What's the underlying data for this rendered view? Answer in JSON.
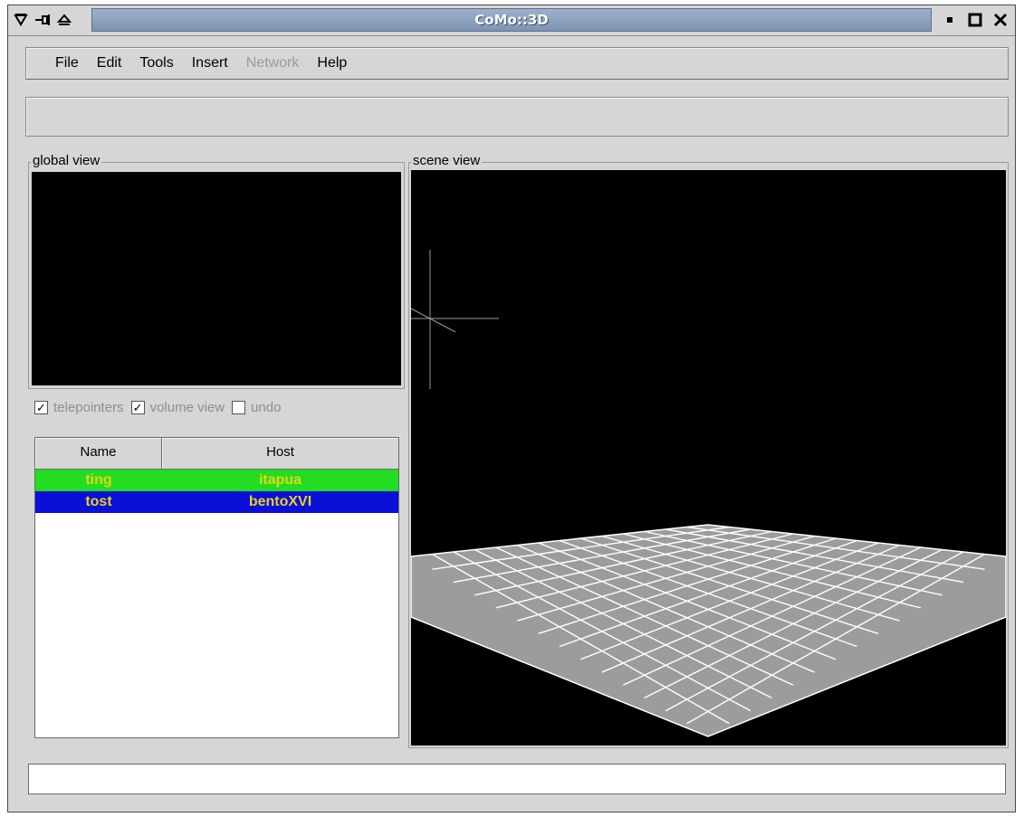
{
  "window": {
    "title": "CoMo::3D",
    "controls_left": [
      "window-menu-icon",
      "pin-icon",
      "shade-icon"
    ],
    "controls_right": [
      "minimize-icon",
      "maximize-icon",
      "close-icon"
    ]
  },
  "menu": {
    "file": "File",
    "edit": "Edit",
    "tools": "Tools",
    "insert": "Insert",
    "network": "Network",
    "help": "Help"
  },
  "panels": {
    "global_view": "global view",
    "scene_view": "scene view"
  },
  "options": {
    "telepointers": {
      "label": "telepointers",
      "checked": true
    },
    "volume_view": {
      "label": "volume view",
      "checked": true
    },
    "undo": {
      "label": "undo",
      "checked": false
    }
  },
  "users_table": {
    "columns": [
      "Name",
      "Host"
    ],
    "rows": [
      {
        "name": "ting",
        "host": "itapua",
        "color": "#22dd22"
      },
      {
        "name": "tost",
        "host": "bentoXVI",
        "color": "#0a10d8"
      }
    ]
  },
  "status": {
    "text": ""
  }
}
